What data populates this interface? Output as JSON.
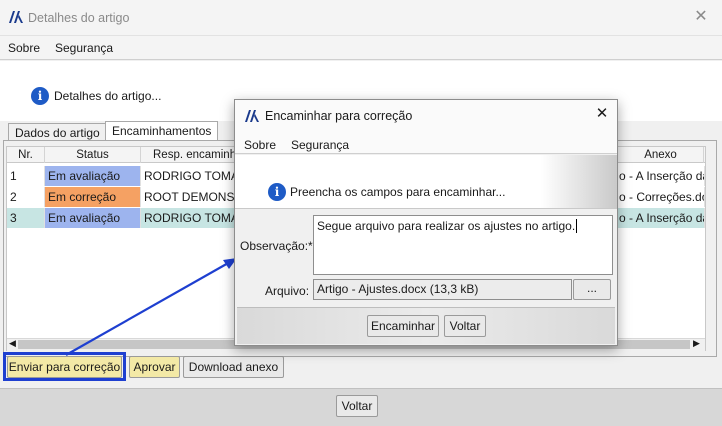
{
  "main_window": {
    "title": "Detalhes do artigo",
    "menu": {
      "sobre": "Sobre",
      "seguranca": "Segurança"
    },
    "info_text": "Detalhes do artigo...",
    "tabs": [
      "Dados do artigo",
      "Encaminhamentos"
    ],
    "table": {
      "columns": [
        "Nr.",
        "Status",
        "Resp. encaminhamento",
        "Anexo"
      ],
      "rows": [
        {
          "nr": "1",
          "status": "Em avaliação",
          "resp": "RODRIGO TOMÁS",
          "anexo": "o - A Inserção da"
        },
        {
          "nr": "2",
          "status": "Em correção",
          "resp": "ROOT DEMONSTR",
          "anexo": "o - Correções.do"
        },
        {
          "nr": "3",
          "status": "Em avaliação",
          "resp": "RODRIGO TOMÁS",
          "anexo": "o - A Inserção da"
        }
      ]
    },
    "buttons": {
      "enviar": "Enviar para correção",
      "aprovar": "Aprovar",
      "download": "Download anexo",
      "voltar": "Voltar"
    },
    "colors": {
      "avaliacao": "#9db4ee",
      "correcao": "#f5a163",
      "selected_row": "#c7e5e3",
      "highlight_box": "#1e3fd0"
    }
  },
  "dialog": {
    "title": "Encaminhar para correção",
    "menu": {
      "sobre": "Sobre",
      "seguranca": "Segurança"
    },
    "info_text": "Preencha os campos para encaminhar...",
    "observacao_label": "Observação:*",
    "observacao_value": "Segue arquivo para realizar os ajustes no artigo.",
    "arquivo_label": "Arquivo:",
    "arquivo_value": "Artigo - Ajustes.docx (13,3 kB)",
    "browse_label": "...",
    "buttons": {
      "encaminhar": "Encaminhar",
      "voltar": "Voltar"
    }
  },
  "icons": [
    "app-logo-icon",
    "close-icon",
    "info-icon",
    "scroll-left-icon",
    "scroll-right-icon",
    "arrow-annotation"
  ]
}
